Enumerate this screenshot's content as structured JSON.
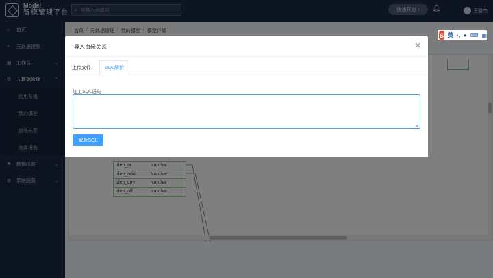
{
  "header": {
    "logo_en": "Model",
    "logo_zh": "智模管理平台",
    "search_placeholder": "请输入关键词",
    "quick_start": "快速开始",
    "user_name": "王骏杰"
  },
  "sidebar": {
    "items": [
      {
        "label": "首页"
      },
      {
        "label": "元数据搜索"
      },
      {
        "label": "工作台"
      },
      {
        "label": "元数据管理"
      },
      {
        "label": "应用系统"
      },
      {
        "label": "我的模型"
      },
      {
        "label": "血缘关系"
      },
      {
        "label": "差异报告"
      },
      {
        "label": "数据标准"
      },
      {
        "label": "系统配置"
      }
    ]
  },
  "breadcrumb": [
    "首页",
    "元数据管理",
    "我的模型",
    "模型详情"
  ],
  "table_rows": [
    {
      "name": "iden_nr",
      "type": "varchar"
    },
    {
      "name": "iden_addr",
      "type": "varchar"
    },
    {
      "name": "iden_ctry",
      "type": "varchar"
    },
    {
      "name": "iden_off",
      "type": "varchar"
    }
  ],
  "modal": {
    "title": "导入血缘关系",
    "tabs": [
      {
        "label": "上传文件"
      },
      {
        "label": "SQL解析"
      }
    ],
    "field_label": "加工SQL语句",
    "textarea_value": "",
    "parse_button": "解析SQL"
  },
  "ime": {
    "logo": "S",
    "lang": "英"
  },
  "colors": {
    "sidebar_bg": "#1b2a45",
    "primary": "#409eff",
    "table_border": "#9ccf9a"
  }
}
